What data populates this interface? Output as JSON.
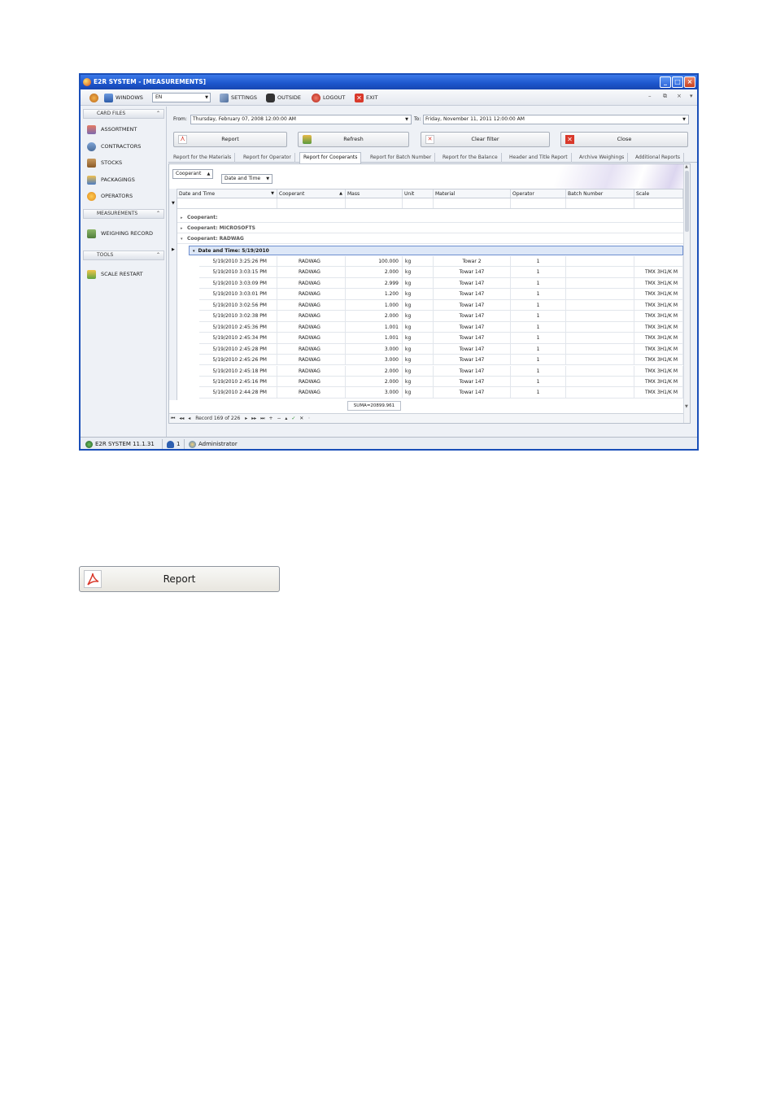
{
  "window": {
    "title": "E2R SYSTEM - [MEASUREMENTS]",
    "buttons": [
      "_",
      "□",
      "×"
    ]
  },
  "menu": {
    "windows": "WINDOWS",
    "language": "EN",
    "settings": "SETTINGS",
    "outside": "OUTSIDE",
    "logout": "LOGOUT",
    "exit": "EXIT",
    "mdi_controls": [
      "–",
      "⧉",
      "×",
      "▾"
    ]
  },
  "sidebar": {
    "groups": [
      {
        "label": "CARD FILES",
        "items": [
          "ASSORTMENT",
          "CONTRACTORS",
          "STOCKS",
          "PACKAGINGS",
          "OPERATORS"
        ]
      },
      {
        "label": "MEASUREMENTS",
        "items": [
          "WEIGHING RECORD"
        ]
      },
      {
        "label": "TOOLS",
        "items": [
          "SCALE RESTART"
        ]
      }
    ]
  },
  "filters": {
    "from_label": "From:",
    "from_value": "Thursday, February 07, 2008 12:00:00 AM",
    "to_label": "To:",
    "to_value": "Friday, November 11, 2011 12:00:00 AM"
  },
  "buttons": {
    "report": "Report",
    "refresh": "Refresh",
    "clear_filter": "Clear filter",
    "close": "Close"
  },
  "tabs": [
    "Report for the Materials",
    "Report for Operator",
    "Report for Cooperants",
    "Report for Batch Number",
    "Report for the Balance",
    "Header and Title Report",
    "Archive Weighings",
    "Additional Reports"
  ],
  "active_tab": "Report for Cooperants",
  "grouping": {
    "chip1": "Cooperant",
    "chip2": "Date and Time"
  },
  "columns": [
    "Date and Time",
    "Cooperant",
    "Mass",
    "Unit",
    "Material",
    "Operator",
    "Batch Number",
    "Scale"
  ],
  "groups": {
    "cooperant_1": "Cooperant:",
    "cooperant_2": "Cooperant: MICROSOFTS",
    "cooperant_3": "Cooperant: RADWAG",
    "date_group": "Date and Time: 5/19/2010"
  },
  "rows": [
    {
      "dt": "5/19/2010 3:25:26 PM",
      "co": "RADWAG",
      "mass": "100.000",
      "unit": "kg",
      "mat": "Towar 2",
      "op": "1",
      "bn": "",
      "sc": ""
    },
    {
      "dt": "5/19/2010 3:03:15 PM",
      "co": "RADWAG",
      "mass": "2.000",
      "unit": "kg",
      "mat": "Towar 147",
      "op": "1",
      "bn": "",
      "sc": "TMX 3H1/K M"
    },
    {
      "dt": "5/19/2010 3:03:09 PM",
      "co": "RADWAG",
      "mass": "2.999",
      "unit": "kg",
      "mat": "Towar 147",
      "op": "1",
      "bn": "",
      "sc": "TMX 3H1/K M"
    },
    {
      "dt": "5/19/2010 3:03:01 PM",
      "co": "RADWAG",
      "mass": "1.200",
      "unit": "kg",
      "mat": "Towar 147",
      "op": "1",
      "bn": "",
      "sc": "TMX 3H1/K M"
    },
    {
      "dt": "5/19/2010 3:02:56 PM",
      "co": "RADWAG",
      "mass": "1.000",
      "unit": "kg",
      "mat": "Towar 147",
      "op": "1",
      "bn": "",
      "sc": "TMX 3H1/K M"
    },
    {
      "dt": "5/19/2010 3:02:38 PM",
      "co": "RADWAG",
      "mass": "2.000",
      "unit": "kg",
      "mat": "Towar 147",
      "op": "1",
      "bn": "",
      "sc": "TMX 3H1/K M"
    },
    {
      "dt": "5/19/2010 2:45:36 PM",
      "co": "RADWAG",
      "mass": "1.001",
      "unit": "kg",
      "mat": "Towar 147",
      "op": "1",
      "bn": "",
      "sc": "TMX 3H1/K M"
    },
    {
      "dt": "5/19/2010 2:45:34 PM",
      "co": "RADWAG",
      "mass": "1.001",
      "unit": "kg",
      "mat": "Towar 147",
      "op": "1",
      "bn": "",
      "sc": "TMX 3H1/K M"
    },
    {
      "dt": "5/19/2010 2:45:28 PM",
      "co": "RADWAG",
      "mass": "3.000",
      "unit": "kg",
      "mat": "Towar 147",
      "op": "1",
      "bn": "",
      "sc": "TMX 3H1/K M"
    },
    {
      "dt": "5/19/2010 2:45:26 PM",
      "co": "RADWAG",
      "mass": "3.000",
      "unit": "kg",
      "mat": "Towar 147",
      "op": "1",
      "bn": "",
      "sc": "TMX 3H1/K M"
    },
    {
      "dt": "5/19/2010 2:45:18 PM",
      "co": "RADWAG",
      "mass": "2.000",
      "unit": "kg",
      "mat": "Towar 147",
      "op": "1",
      "bn": "",
      "sc": "TMX 3H1/K M"
    },
    {
      "dt": "5/19/2010 2:45:16 PM",
      "co": "RADWAG",
      "mass": "2.000",
      "unit": "kg",
      "mat": "Towar 147",
      "op": "1",
      "bn": "",
      "sc": "TMX 3H1/K M"
    },
    {
      "dt": "5/19/2010 2:44:28 PM",
      "co": "RADWAG",
      "mass": "3.000",
      "unit": "kg",
      "mat": "Towar 147",
      "op": "1",
      "bn": "",
      "sc": "TMX 3H1/K M"
    }
  ],
  "sum": "SUMA=20899.961",
  "navigator": {
    "record": "Record 169 of 226",
    "controls": [
      "⏮",
      "◂◂",
      "◂",
      "▸",
      "▸▸",
      "⏭",
      "+",
      "−",
      "▴",
      "✓",
      "✕",
      "◦"
    ]
  },
  "status": {
    "version": "E2R SYSTEM 11.1.31",
    "users": "1",
    "user": "Administrator"
  },
  "zoom_button": "Report",
  "colors": {
    "title_blue": "#1c55cc",
    "accent_red": "#d9392b"
  }
}
